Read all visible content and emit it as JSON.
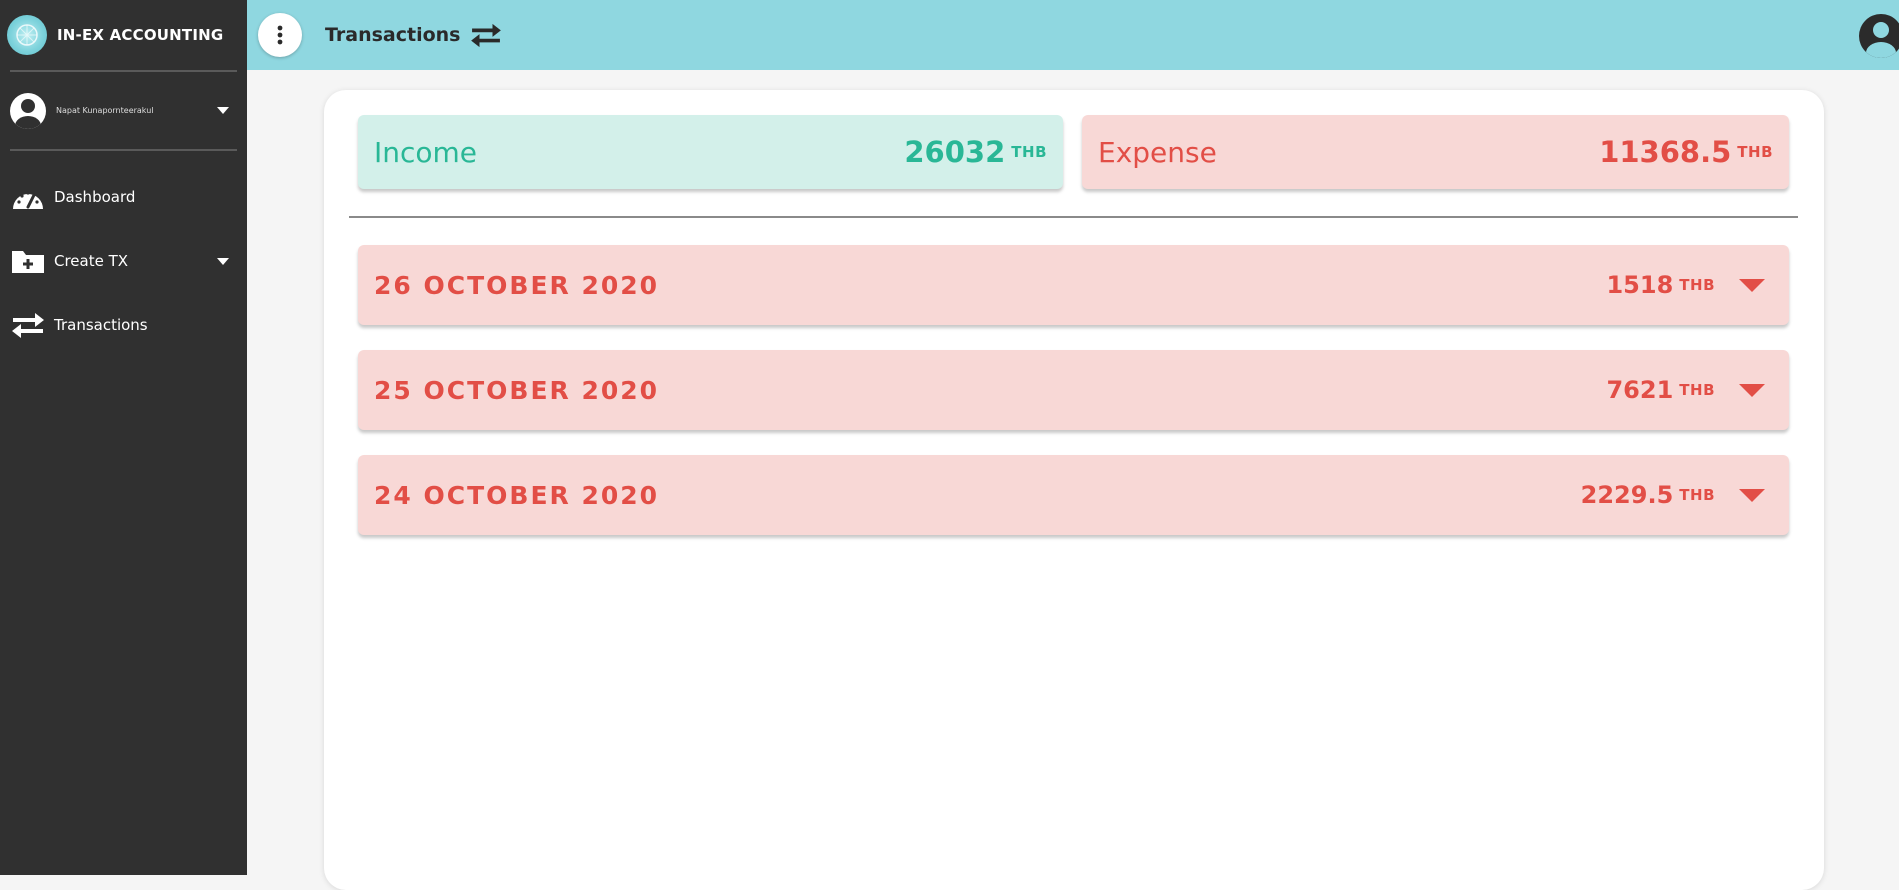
{
  "app": {
    "brand": "IN-EX ACCOUNTING"
  },
  "user": {
    "name": "Napat Kunapornteerakul"
  },
  "sidebar": {
    "items": [
      {
        "label": "Dashboard",
        "icon": "speedometer-icon"
      },
      {
        "label": "Create TX",
        "icon": "folder-plus-icon"
      },
      {
        "label": "Transactions",
        "icon": "swap-arrows-icon"
      }
    ]
  },
  "header": {
    "title": "Transactions",
    "title_icon": "swap-arrows-icon"
  },
  "summary": {
    "income": {
      "label": "Income",
      "amount": "26032",
      "unit": "THB",
      "color": "#29b796"
    },
    "expense": {
      "label": "Expense",
      "amount": "11368.5",
      "unit": "THB",
      "color": "#e24e46"
    }
  },
  "days": [
    {
      "date": "26 OCTOBER 2020",
      "amount": "1518",
      "unit": "THB"
    },
    {
      "date": "25 OCTOBER 2020",
      "amount": "7621",
      "unit": "THB"
    },
    {
      "date": "24 OCTOBER 2020",
      "amount": "2229.5",
      "unit": "THB"
    }
  ],
  "colors": {
    "sidebar_bg": "#303030",
    "topbar_bg": "#8fd7e0",
    "income_bg": "#d3f0ea",
    "expense_bg": "#f8d8d6"
  }
}
